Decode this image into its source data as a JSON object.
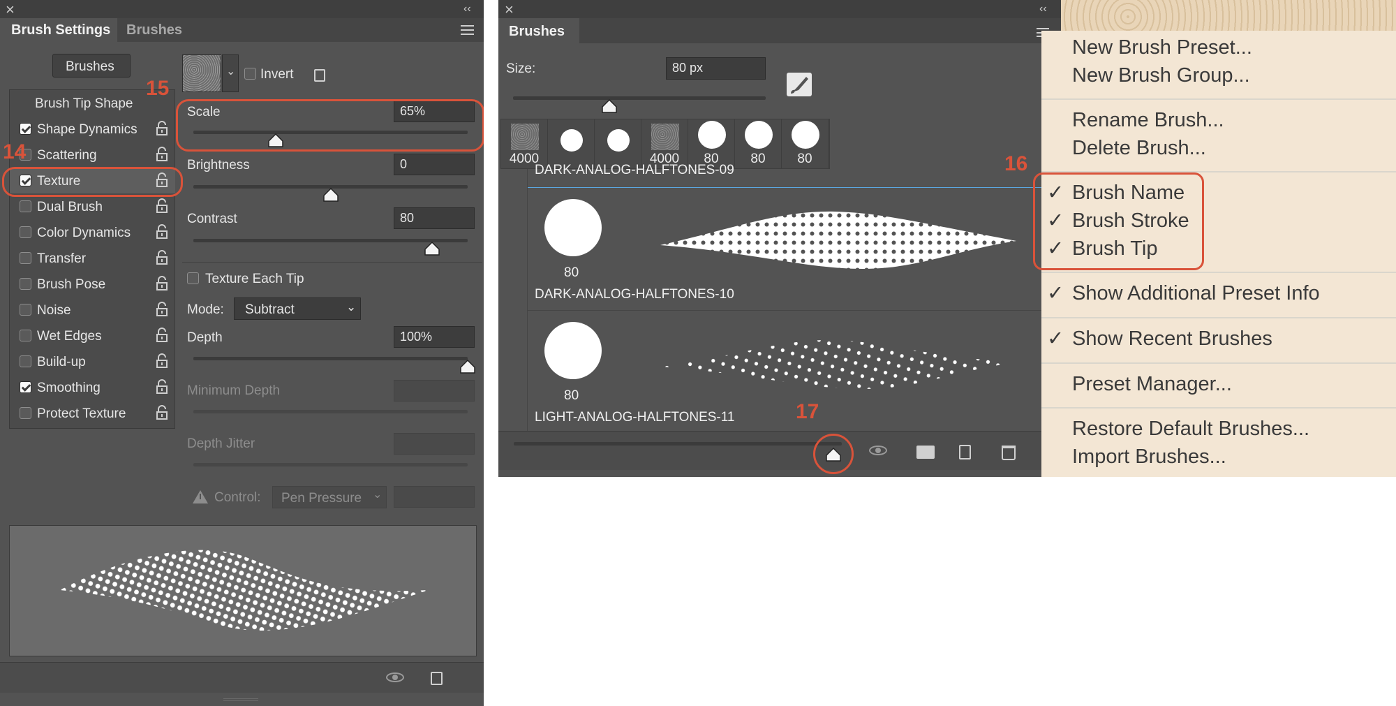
{
  "left_panel": {
    "close_glyph": "×",
    "collapse_glyph": "‹‹",
    "tabs": [
      "Brush Settings",
      "Brushes"
    ],
    "brushes_button": "Brushes",
    "brush_tip_shape": "Brush Tip Shape",
    "options": [
      {
        "label": "Shape Dynamics",
        "checked": true
      },
      {
        "label": "Scattering",
        "checked": false
      },
      {
        "label": "Texture",
        "checked": true
      },
      {
        "label": "Dual Brush",
        "checked": false
      },
      {
        "label": "Color Dynamics",
        "checked": false
      },
      {
        "label": "Transfer",
        "checked": false
      },
      {
        "label": "Brush Pose",
        "checked": false
      },
      {
        "label": "Noise",
        "checked": false
      },
      {
        "label": "Wet Edges",
        "checked": false
      },
      {
        "label": "Build-up",
        "checked": false
      },
      {
        "label": "Smoothing",
        "checked": true
      },
      {
        "label": "Protect Texture",
        "checked": false
      }
    ],
    "texture": {
      "invert_label": "Invert",
      "invert_checked": false,
      "scale_label": "Scale",
      "scale_value": "65%",
      "brightness_label": "Brightness",
      "brightness_value": "0",
      "contrast_label": "Contrast",
      "contrast_value": "80",
      "texture_each_tip_label": "Texture Each Tip",
      "texture_each_tip_checked": false,
      "mode_label": "Mode:",
      "mode_value": "Subtract",
      "depth_label": "Depth",
      "depth_value": "100%",
      "min_depth_label": "Minimum Depth",
      "depth_jitter_label": "Depth Jitter",
      "control_label": "Control:",
      "control_value": "Pen Pressure",
      "scale_level": 0.3,
      "brightness_level": 0.5,
      "contrast_level": 0.87,
      "depth_level": 1.0
    }
  },
  "right_panel": {
    "close_glyph": "×",
    "collapse_glyph": "‹‹",
    "tab": "Brushes",
    "size_label": "Size:",
    "size_value": "80 px",
    "size_level": 0.38,
    "recent_brushes": [
      "4000",
      "",
      "",
      "4000",
      "80",
      "80",
      "80"
    ],
    "list": [
      {
        "name": "DARK-ANALOG-HALFTONES-09"
      },
      {
        "name": "DARK-ANALOG-HALFTONES-10",
        "size": "80"
      },
      {
        "name": "LIGHT-ANALOG-HALFTONES-11",
        "size": "80"
      }
    ]
  },
  "menu": {
    "items": [
      {
        "label": "New Brush Preset...",
        "check": ""
      },
      {
        "label": "New Brush Group...",
        "check": ""
      },
      {
        "label": "Rename Brush...",
        "check": ""
      },
      {
        "label": "Delete Brush...",
        "check": ""
      },
      {
        "label": "Brush Name",
        "check": "✓"
      },
      {
        "label": "Brush Stroke",
        "check": "✓"
      },
      {
        "label": "Brush Tip",
        "check": "✓"
      },
      {
        "label": "Show Additional Preset Info",
        "check": "✓"
      },
      {
        "label": "Show Recent Brushes",
        "check": "✓"
      },
      {
        "label": "Preset Manager...",
        "check": ""
      },
      {
        "label": "Restore Default Brushes...",
        "check": ""
      },
      {
        "label": "Import Brushes...",
        "check": ""
      }
    ]
  },
  "annotations": [
    "14",
    "15",
    "16",
    "17"
  ],
  "colors": {
    "panel_bg": "#535353",
    "annotation_red": "#d9533a",
    "menu_bg": "#f3e6d4"
  }
}
